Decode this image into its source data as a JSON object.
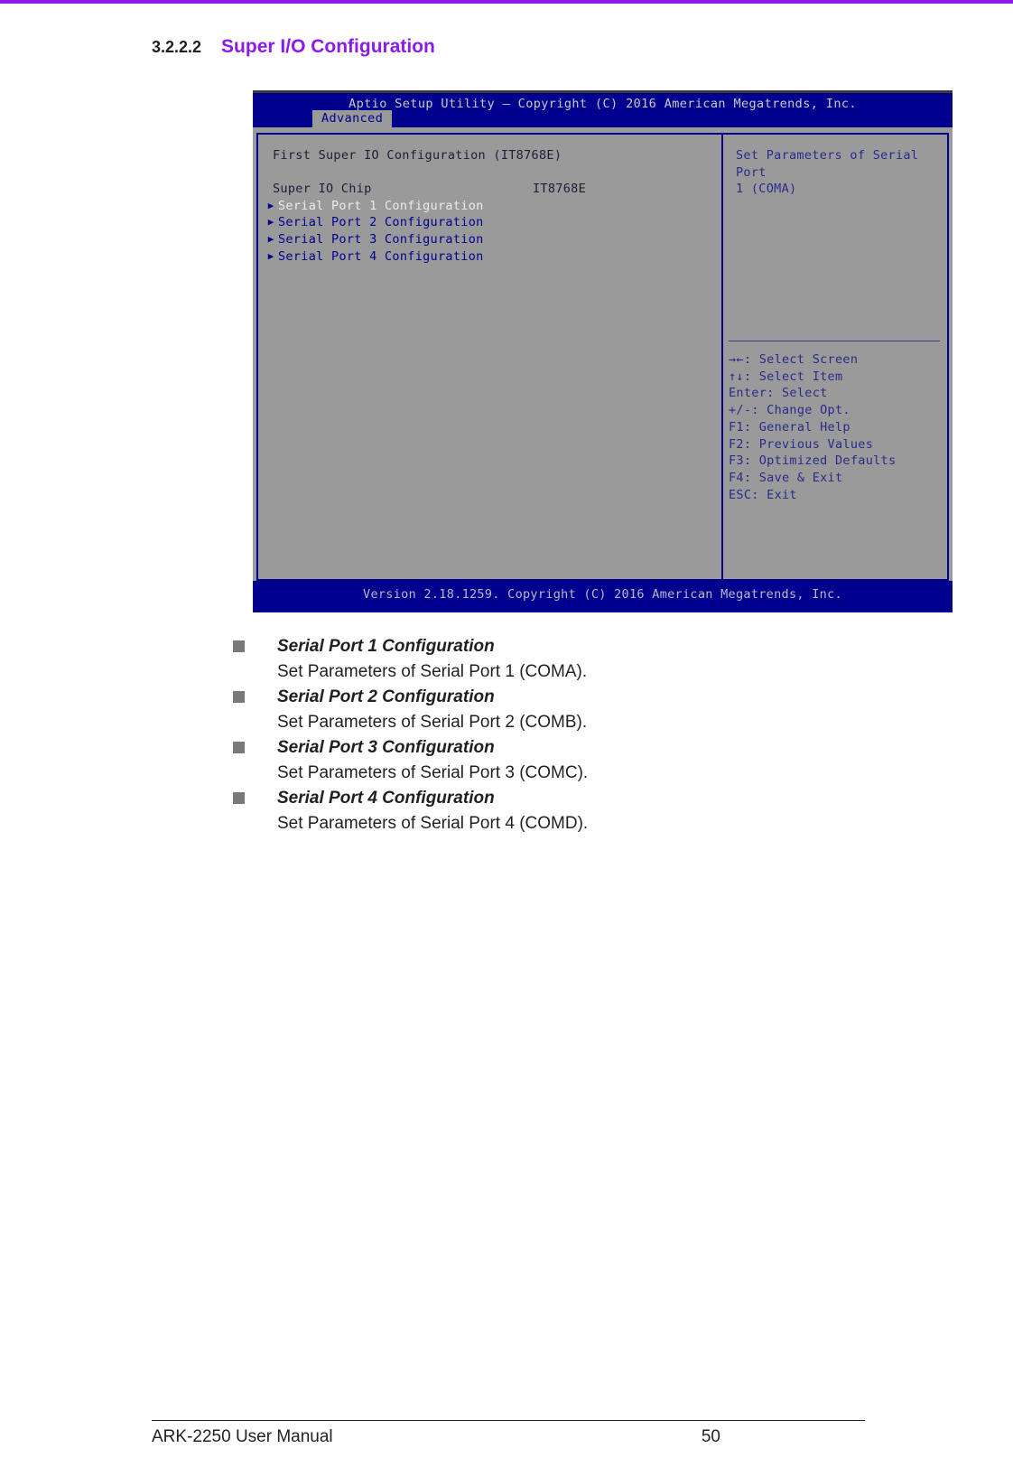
{
  "heading": {
    "number": "3.2.2.2",
    "title": "Super I/O Configuration"
  },
  "bios": {
    "title": "Aptio Setup Utility – Copyright (C) 2016 American Megatrends, Inc.",
    "active_tab": "Advanced",
    "section_title": "First Super IO Configuration (IT8768E)",
    "chip_label": "Super IO Chip",
    "chip_value": "IT8768E",
    "menu_items": [
      {
        "label": "Serial Port 1 Configuration",
        "marker": "▶",
        "selected": true
      },
      {
        "label": "Serial Port 2 Configuration",
        "marker": "▶",
        "selected": false
      },
      {
        "label": "Serial Port 3 Configuration",
        "marker": "▶",
        "selected": false
      },
      {
        "label": "Serial Port 4 Configuration",
        "marker": "▶",
        "selected": false
      }
    ],
    "help_text": "Set Parameters of Serial Port\n1 (COMA)",
    "keys": [
      "→←: Select Screen",
      "↑↓: Select Item",
      "Enter: Select",
      "+/-: Change Opt.",
      "F1: General Help",
      "F2: Previous Values",
      "F3: Optimized Defaults",
      "F4: Save & Exit",
      "ESC: Exit"
    ],
    "footer": "Version 2.18.1259. Copyright (C) 2016 American Megatrends, Inc.",
    "colors": {
      "bar_blue": "#00008f",
      "panel_gray": "#9a9a9a",
      "text_blue": "#00008f",
      "selected_text": "#ebebeb"
    }
  },
  "bullets": [
    {
      "title": "Serial Port 1 Configuration",
      "desc": "Set Parameters of Serial Port 1 (COMA)."
    },
    {
      "title": "Serial Port 2 Configuration",
      "desc": "Set Parameters of Serial Port 2 (COMB)."
    },
    {
      "title": "Serial Port 3 Configuration",
      "desc": "Set Parameters of Serial Port 3 (COMC)."
    },
    {
      "title": "Serial Port 4 Configuration",
      "desc": "Set Parameters of Serial Port 4 (COMD)."
    }
  ],
  "page_footer": {
    "manual": "ARK-2250 User Manual",
    "page": "50"
  }
}
